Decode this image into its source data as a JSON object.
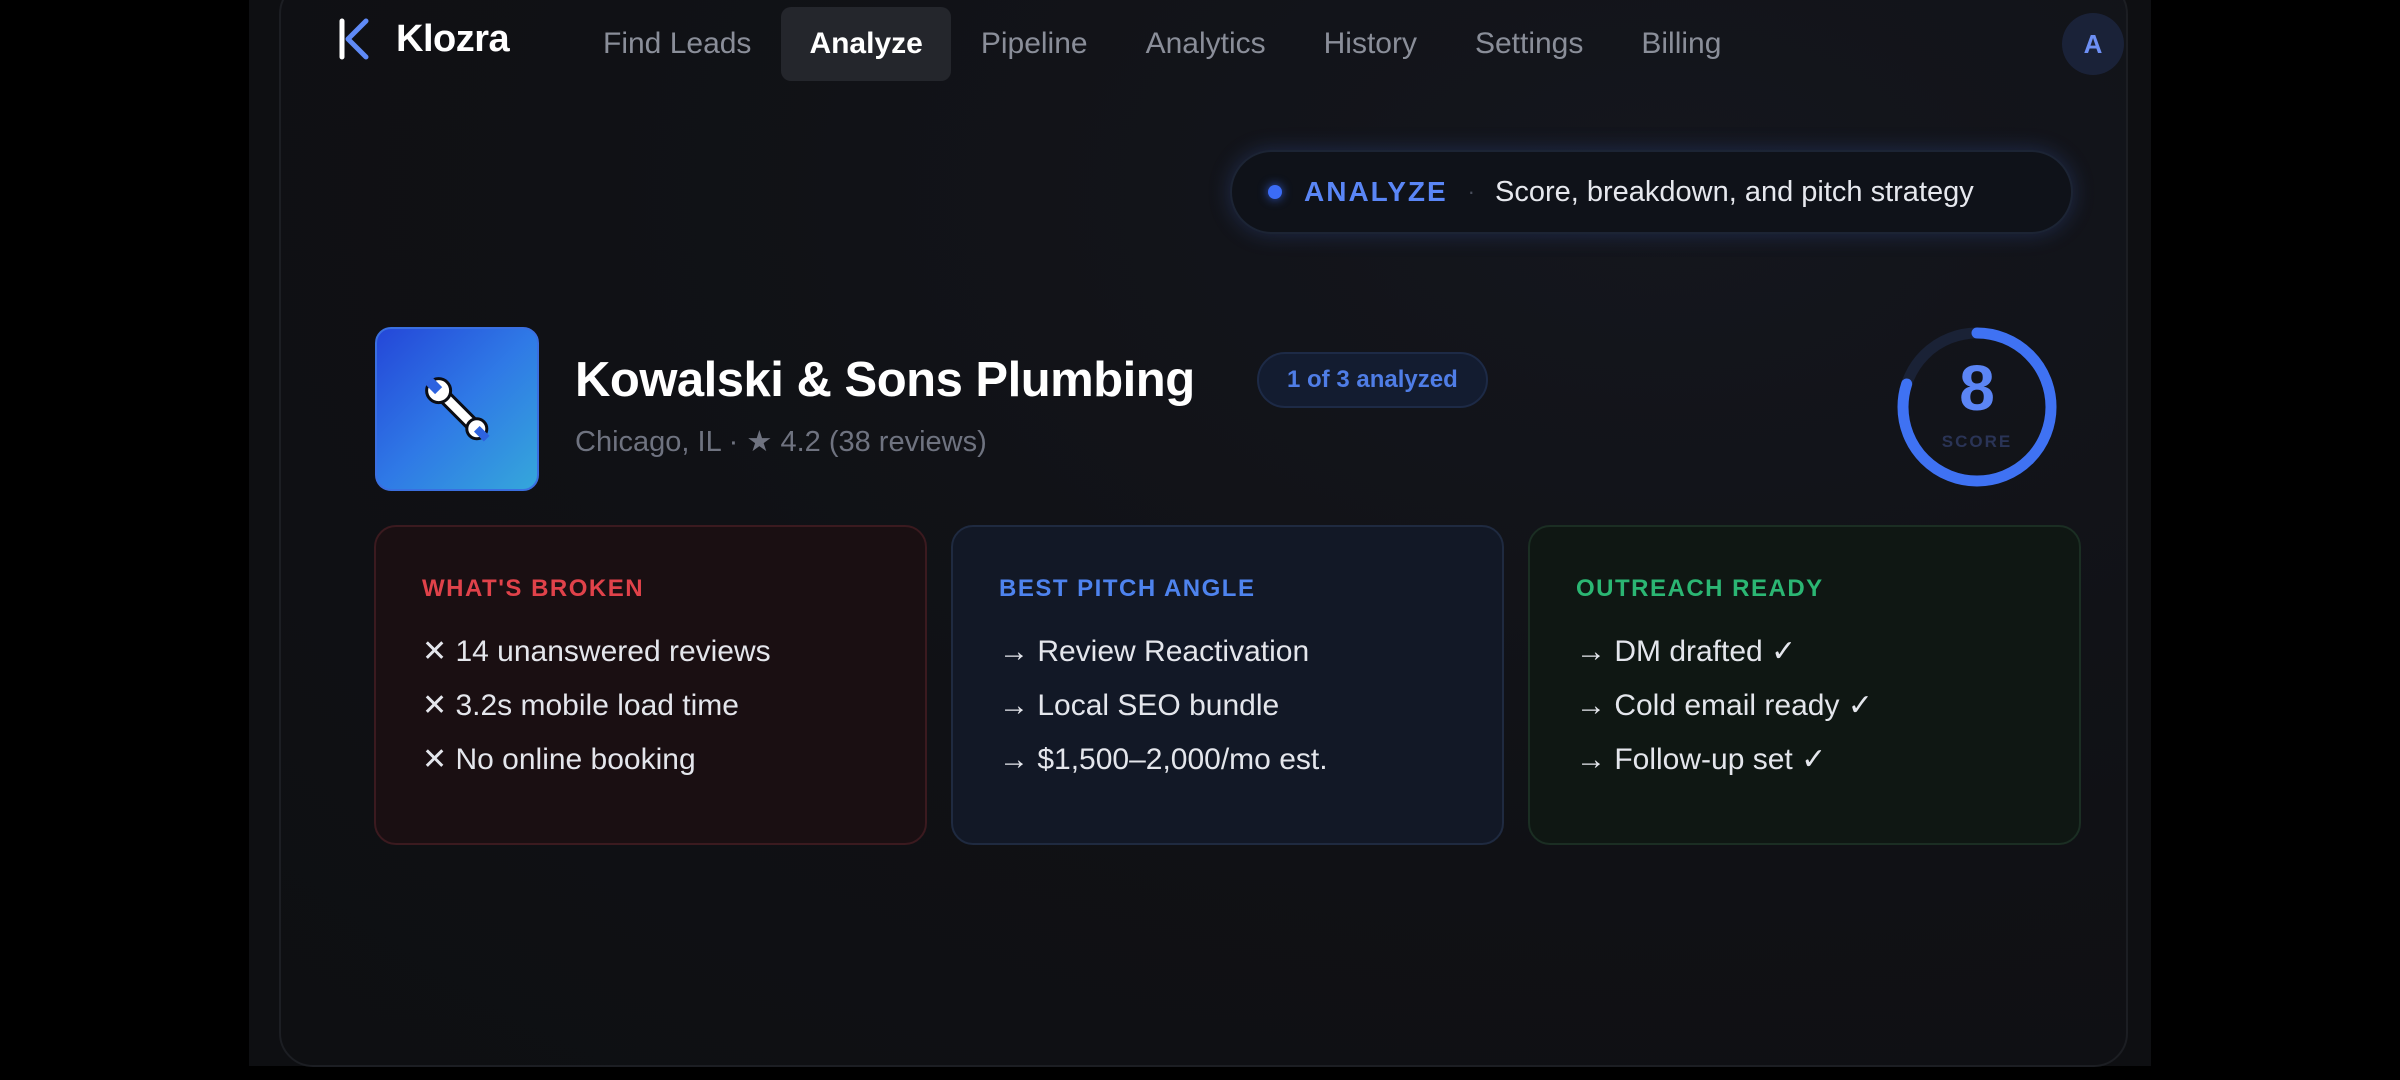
{
  "app": {
    "brand_name": "Klozra",
    "avatar_initial": "A"
  },
  "nav": {
    "items": [
      {
        "label": "Find Leads"
      },
      {
        "label": "Analyze",
        "active": true
      },
      {
        "label": "Pipeline"
      },
      {
        "label": "Analytics"
      },
      {
        "label": "History"
      },
      {
        "label": "Settings"
      },
      {
        "label": "Billing"
      }
    ]
  },
  "pill": {
    "tag": "ANALYZE",
    "separator": "·",
    "description": "Score, breakdown, and pitch strategy"
  },
  "business": {
    "icon": "wrench-icon",
    "name": "Kowalski & Sons Plumbing",
    "meta": "Chicago, IL · ★ 4.2 (38 reviews)",
    "progress_badge": "1 of 3 analyzed"
  },
  "score": {
    "value": "8",
    "label": "SCORE",
    "ring_fill_fraction": 0.8
  },
  "cards": {
    "broken": {
      "title": "WHAT'S BROKEN",
      "items": [
        "✕ 14 unanswered reviews",
        "✕ 3.2s mobile load time",
        "✕ No online booking"
      ]
    },
    "pitch": {
      "title": "BEST PITCH ANGLE",
      "items": [
        "→ Review Reactivation",
        "→ Local SEO bundle",
        "→ $1,500–2,000/mo est."
      ]
    },
    "outreach": {
      "title": "OUTREACH READY",
      "items": [
        "→ DM drafted ✓",
        "→ Cold email ready ✓",
        "→ Follow-up set ✓"
      ]
    }
  },
  "colors": {
    "accent": "#3b6cf6",
    "danger": "#e0424a",
    "success": "#2bb673",
    "background": "#0e0f12"
  }
}
